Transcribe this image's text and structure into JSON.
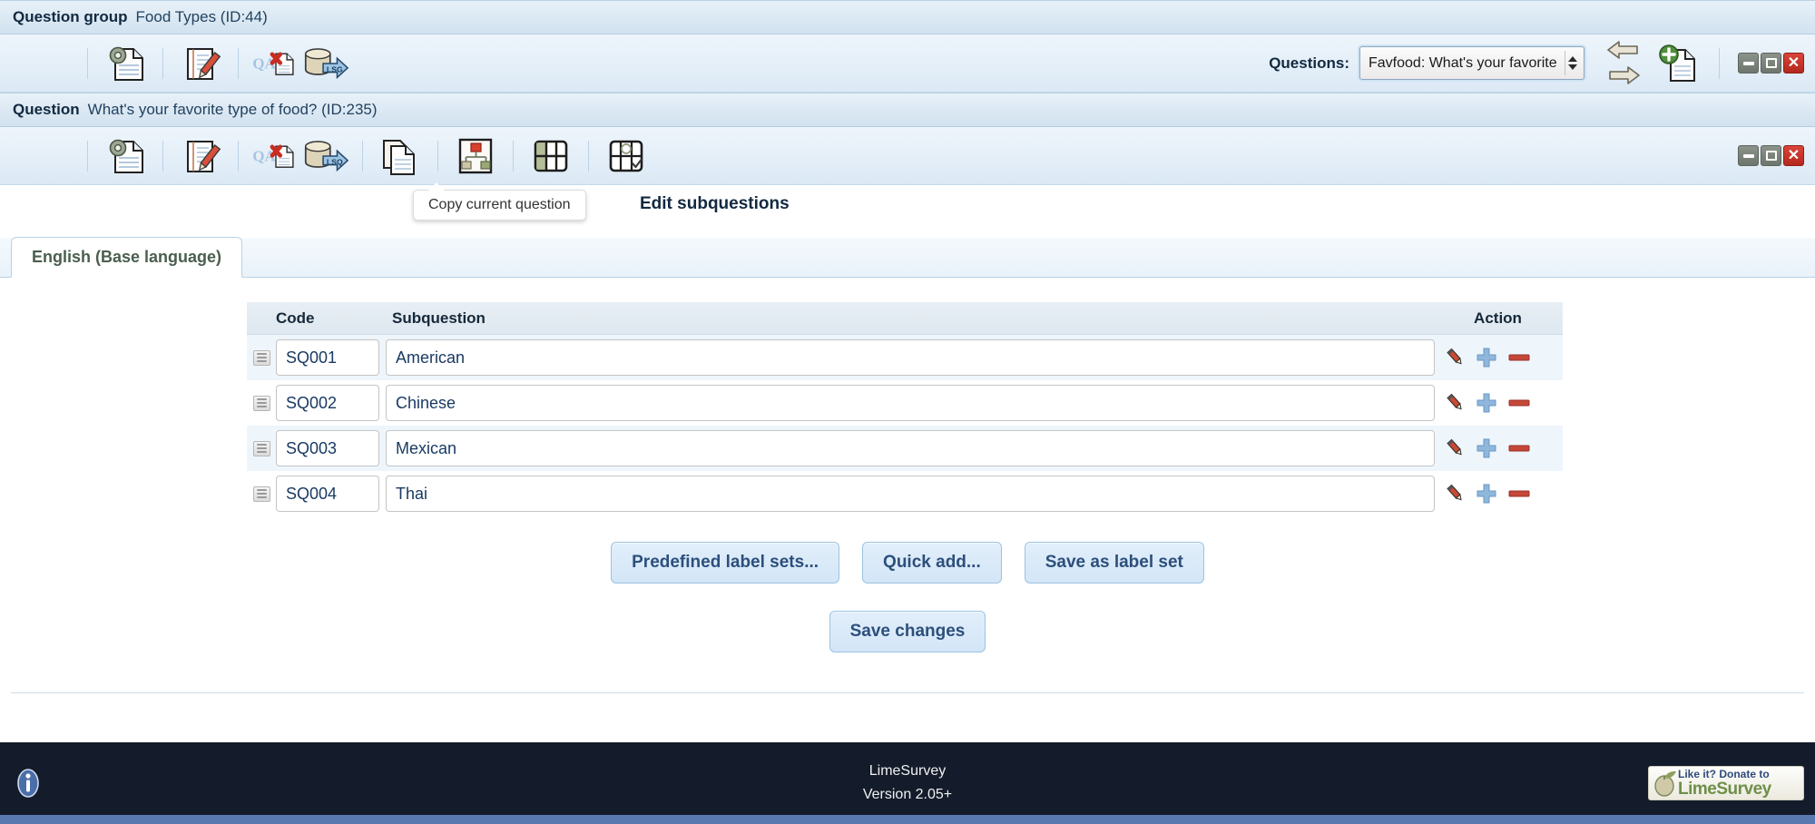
{
  "group": {
    "label": "Question group",
    "name": "Food Types (ID:44)",
    "toolbar": [
      {
        "name": "group-properties-icon",
        "title": "Group properties"
      },
      {
        "name": "edit-group-icon",
        "title": "Edit group"
      },
      {
        "name": "delete-group-icon",
        "title": "Delete group"
      },
      {
        "name": "export-group-icon",
        "title": "Export group"
      }
    ],
    "questions_label": "Questions:",
    "selected_question": "Favfood: What's your favorite",
    "window_buttons": [
      "minimize",
      "maximize",
      "close"
    ]
  },
  "question": {
    "label": "Question",
    "name": "What's your favorite type of food? (ID:235)",
    "toolbar": [
      {
        "name": "question-properties-icon"
      },
      {
        "name": "edit-question-icon"
      },
      {
        "name": "check-question-icon"
      },
      {
        "name": "delete-question-icon"
      },
      {
        "name": "export-question-icon"
      },
      {
        "name": "copy-question-icon"
      },
      {
        "name": "conditions-icon"
      },
      {
        "name": "edit-subquestions-icon"
      },
      {
        "name": "edit-answer-options-icon"
      }
    ],
    "window_buttons": [
      "minimize",
      "maximize",
      "close"
    ]
  },
  "tooltip": "Copy current question",
  "section_heading": "Edit subquestions",
  "language_tab": "English (Base language)",
  "table": {
    "headers": {
      "handle": "",
      "code": "Code",
      "subquestion": "Subquestion",
      "action": "Action"
    },
    "rows": [
      {
        "code": "SQ001",
        "subquestion": "American"
      },
      {
        "code": "SQ002",
        "subquestion": "Chinese"
      },
      {
        "code": "SQ003",
        "subquestion": "Mexican"
      },
      {
        "code": "SQ004",
        "subquestion": "Thai"
      }
    ],
    "row_actions": [
      {
        "name": "edit-icon"
      },
      {
        "name": "add-icon"
      },
      {
        "name": "remove-icon"
      }
    ]
  },
  "buttons": {
    "predefined_label_sets": "Predefined label sets...",
    "quick_add": "Quick add...",
    "save_as_label_set": "Save as label set",
    "save_changes": "Save changes"
  },
  "footer": {
    "product": "LimeSurvey",
    "version": "Version 2.05+",
    "donate_line1": "Like it? Donate to",
    "donate_line2": "LimeSurvey"
  },
  "colors": {
    "accent": "#2c4f7c",
    "header_bg": "#dce9f4",
    "footer_bg": "#141c2b",
    "input_text": "#1a3a63",
    "close_red": "#c0392b"
  }
}
